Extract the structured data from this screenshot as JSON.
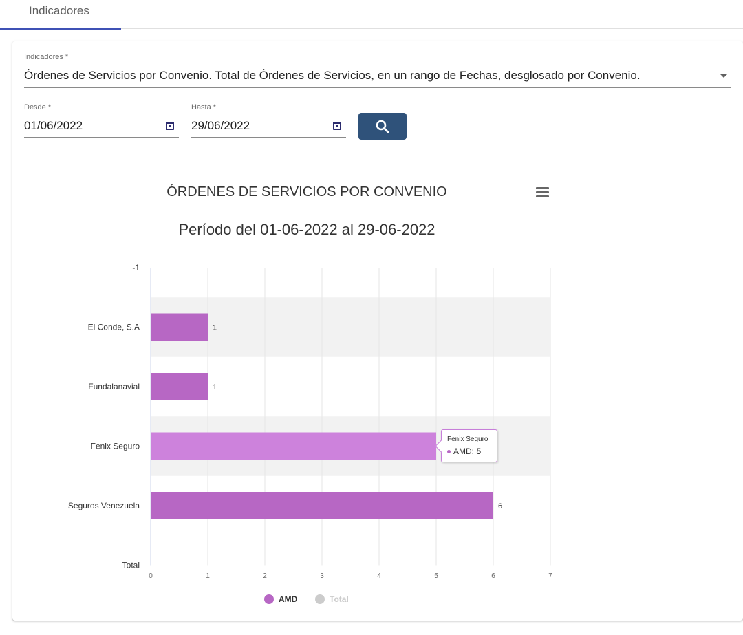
{
  "tabs": [
    {
      "label": "Indicadores",
      "active": true
    }
  ],
  "form": {
    "indicador": {
      "label": "Indicadores *",
      "value": "Órdenes de Servicios por Convenio. Total de Órdenes de Servicios, en un rango de Fechas, desglosado por Convenio."
    },
    "desde": {
      "label": "Desde *",
      "value": "01/06/2022"
    },
    "hasta": {
      "label": "Hasta *",
      "value": "29/06/2022"
    },
    "search_icon": "search-icon",
    "calendar_icon": "calendar-icon"
  },
  "colors": {
    "accent": "#3f51b5",
    "button": "#2f527a",
    "series_amd": "#b767c4",
    "series_amd_hover": "#cd82dc",
    "series_total": "#cccccc",
    "band": "#f2f2f2"
  },
  "chart_data": {
    "type": "bar",
    "orientation": "horizontal",
    "title": "ÓRDENES DE SERVICIOS POR CONVENIO",
    "subtitle": "Período del 01-06-2022 al 29-06-2022",
    "categories": [
      "-1",
      "El Conde, S.A",
      "Fundalanavial",
      "Fenix Seguro",
      "Seguros Venezuela",
      "Total"
    ],
    "series": [
      {
        "name": "AMD",
        "color": "#b767c4",
        "values": [
          null,
          1,
          1,
          5,
          6,
          null
        ]
      },
      {
        "name": "Total",
        "color": "#cccccc",
        "visible": false,
        "values": [
          null,
          null,
          null,
          null,
          null,
          null
        ]
      }
    ],
    "xlim": [
      0,
      7
    ],
    "x_ticks": [
      0,
      1,
      2,
      3,
      4,
      5,
      6,
      7
    ],
    "grid": true,
    "legend": "bottom-center",
    "tooltip": {
      "category": "Fenix Seguro",
      "series": "AMD",
      "label": "AMD: ",
      "value": "5"
    }
  }
}
